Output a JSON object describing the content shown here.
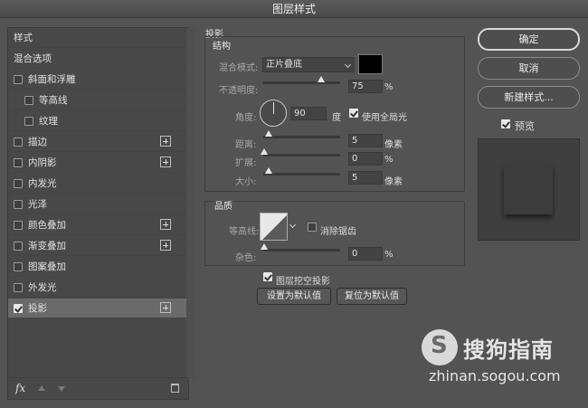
{
  "window": {
    "title": "图层样式"
  },
  "styles_panel": {
    "items": [
      {
        "label": "样式",
        "checkbox": false,
        "checked": false,
        "plus": false,
        "indent": 0
      },
      {
        "label": "混合选项",
        "checkbox": false,
        "checked": false,
        "plus": false,
        "indent": 0
      },
      {
        "label": "斜面和浮雕",
        "checkbox": true,
        "checked": false,
        "plus": false,
        "indent": 0
      },
      {
        "label": "等高线",
        "checkbox": true,
        "checked": false,
        "plus": false,
        "indent": 1
      },
      {
        "label": "纹理",
        "checkbox": true,
        "checked": false,
        "plus": false,
        "indent": 1
      },
      {
        "label": "描边",
        "checkbox": true,
        "checked": false,
        "plus": true,
        "indent": 0
      },
      {
        "label": "内阴影",
        "checkbox": true,
        "checked": false,
        "plus": true,
        "indent": 0
      },
      {
        "label": "内发光",
        "checkbox": true,
        "checked": false,
        "plus": false,
        "indent": 0
      },
      {
        "label": "光泽",
        "checkbox": true,
        "checked": false,
        "plus": false,
        "indent": 0
      },
      {
        "label": "颜色叠加",
        "checkbox": true,
        "checked": false,
        "plus": true,
        "indent": 0
      },
      {
        "label": "渐变叠加",
        "checkbox": true,
        "checked": false,
        "plus": true,
        "indent": 0
      },
      {
        "label": "图案叠加",
        "checkbox": true,
        "checked": false,
        "plus": false,
        "indent": 0
      },
      {
        "label": "外发光",
        "checkbox": true,
        "checked": false,
        "plus": false,
        "indent": 0
      },
      {
        "label": "投影",
        "checkbox": true,
        "checked": true,
        "plus": true,
        "indent": 0,
        "selected": true
      }
    ],
    "fx_label": "fx"
  },
  "drop_shadow": {
    "section_title": "投影",
    "structure_title": "结构",
    "blend_mode_label": "混合模式:",
    "blend_mode_value": "正片叠底",
    "shadow_color": "#000000",
    "opacity_label": "不透明度:",
    "opacity_value": "75",
    "opacity_unit": "%",
    "opacity_fraction": 0.75,
    "angle_label": "角度:",
    "angle_value": "90",
    "angle_unit": "度",
    "global_light_label": "使用全局光",
    "global_light_checked": true,
    "distance_label": "距离:",
    "distance_value": "5",
    "distance_unit": "像素",
    "spread_label": "扩展:",
    "spread_value": "0",
    "spread_unit": "%",
    "size_label": "大小:",
    "size_value": "5",
    "size_unit": "像素",
    "quality_title": "品质",
    "contour_label": "等高线:",
    "antialias_label": "消除锯齿",
    "antialias_checked": false,
    "noise_label": "杂色:",
    "noise_value": "0",
    "noise_unit": "%",
    "knockout_label": "图层挖空投影",
    "knockout_checked": true,
    "set_default_label": "设置为默认值",
    "reset_default_label": "复位为默认值"
  },
  "actions": {
    "ok_label": "确定",
    "cancel_label": "取消",
    "new_style_label": "新建样式...",
    "preview_label": "预览",
    "preview_checked": true
  },
  "watermark": {
    "brand": "搜狗指南",
    "url": "zhinan.sogou.com"
  }
}
